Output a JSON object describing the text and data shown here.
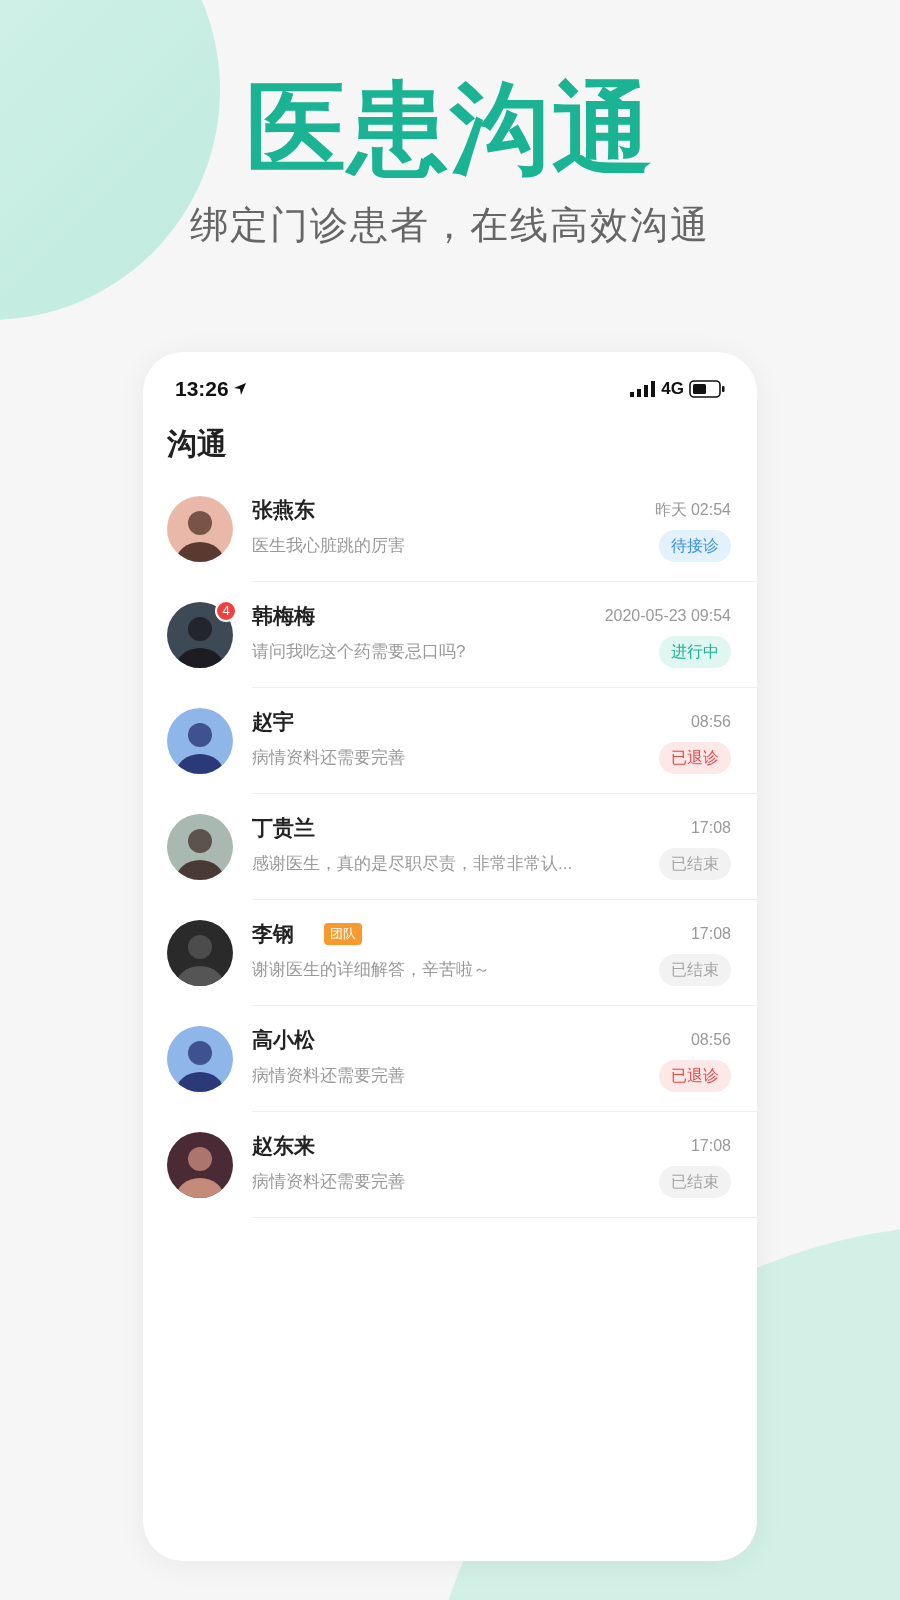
{
  "headline": "医患沟通",
  "subtitle": "绑定门诊患者，在线高效沟通",
  "status_bar": {
    "time": "13:26",
    "network": "4G"
  },
  "screen_title": "沟通",
  "conversations": [
    {
      "name": "张燕东",
      "message": "医生我心脏跳的厉害",
      "time": "昨天 02:54",
      "status": {
        "text": "待接诊",
        "kind": "pending"
      }
    },
    {
      "name": "韩梅梅",
      "message": "请问我吃这个药需要忌口吗?",
      "time": "2020-05-23 09:54",
      "unread": "4",
      "status": {
        "text": "进行中",
        "kind": "ongoing"
      }
    },
    {
      "name": "赵宇",
      "message": "病情资料还需要完善",
      "time": "08:56",
      "status": {
        "text": "已退诊",
        "kind": "withdrawn"
      }
    },
    {
      "name": "丁贵兰",
      "message": "感谢医生，真的是尽职尽责，非常非常认...",
      "time": "17:08",
      "status": {
        "text": "已结束",
        "kind": "ended"
      }
    },
    {
      "name": "李钢",
      "tag": "团队",
      "message": "谢谢医生的详细解答，辛苦啦～",
      "time": "17:08",
      "status": {
        "text": "已结束",
        "kind": "ended"
      }
    },
    {
      "name": "高小松",
      "message": "病情资料还需要完善",
      "time": "08:56",
      "status": {
        "text": "已退诊",
        "kind": "withdrawn"
      }
    },
    {
      "name": "赵东来",
      "message": "病情资料还需要完善",
      "time": "17:08",
      "status": {
        "text": "已结束",
        "kind": "ended"
      }
    }
  ]
}
